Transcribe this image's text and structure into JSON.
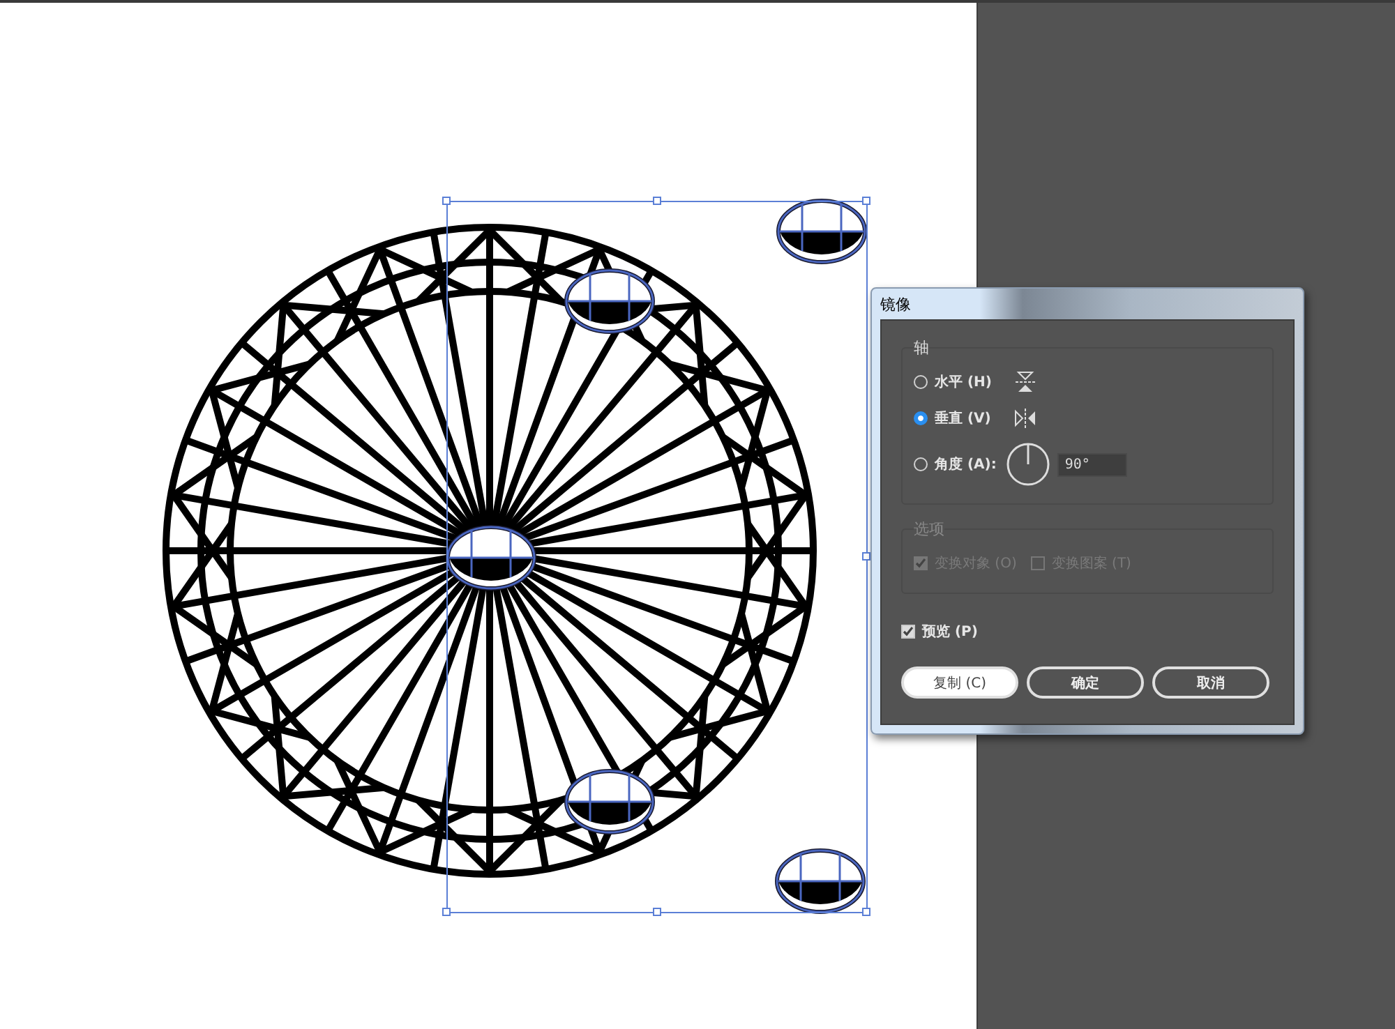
{
  "dialog": {
    "title": "镜像",
    "axis": {
      "label": "轴",
      "options": [
        {
          "kind": "horizontal",
          "label": "水平 (H)",
          "selected": false
        },
        {
          "kind": "vertical",
          "label": "垂直 (V)",
          "selected": true
        },
        {
          "kind": "angle",
          "label": "角度 (A):",
          "selected": false,
          "value": "90°"
        }
      ]
    },
    "options": {
      "label": "选项",
      "disabled": true,
      "checkboxes": [
        {
          "label": "变换对象 (O)",
          "checked": true
        },
        {
          "label": "变换图案 (T)",
          "checked": false
        }
      ]
    },
    "preview": {
      "label": "预览 (P)",
      "checked": true
    },
    "buttons": [
      {
        "label": "复制 (C)",
        "focused": true
      },
      {
        "label": "确定",
        "focused": false
      },
      {
        "label": "取消",
        "focused": false
      }
    ]
  }
}
